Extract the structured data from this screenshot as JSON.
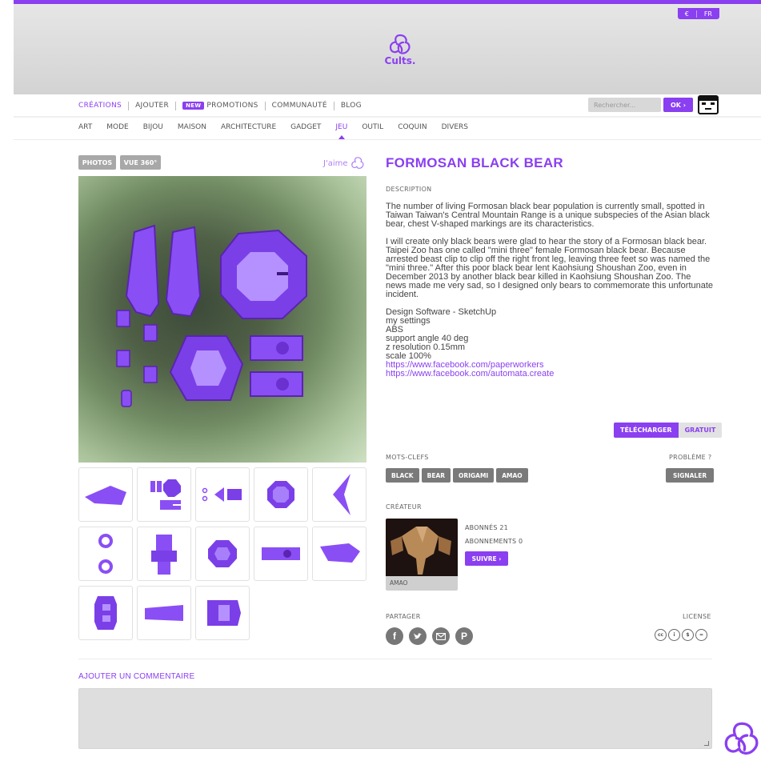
{
  "header": {
    "lang": [
      "€",
      "FR"
    ],
    "logo_word": "Cults.",
    "brand_color": "#8a3ff0"
  },
  "main_nav": {
    "items": [
      {
        "label": "CRÉATIONS"
      },
      {
        "label": "AJOUTER"
      },
      {
        "badge": "NEW",
        "label": "PROMOTIONS"
      },
      {
        "label": "COMMUNAUTÉ"
      },
      {
        "label": "BLOG"
      }
    ],
    "search_placeholder": "Rechercher...",
    "ok_label": "OK ›"
  },
  "sub_nav": [
    "ART",
    "MODE",
    "BIJOU",
    "MAISON",
    "ARCHITECTURE",
    "GADGET",
    "JEU",
    "OUTIL",
    "COQUIN",
    "DIVERS"
  ],
  "gallery": {
    "tab_photos": "PHOTOS",
    "tab_360": "VUE 360°",
    "like_label": "J'aime"
  },
  "product": {
    "title": "FORMOSAN BLACK BEAR",
    "description_label": "DESCRIPTION",
    "paragraphs": [
      "The number of living Formosan black bear population is currently small, spotted in Taiwan Taiwan's Central Mountain Range is a unique subspecies of the Asian black bear, chest V-shaped markings are its characteristics.",
      "I will create only black bears were glad to hear the story of a Formosan black bear.\nTaipei Zoo has one called \"mini three\" female Formosan black bear. Because arrested beast clip to clip off the right front leg, leaving three feet so was named the \"mini three.\" After this poor black bear lent Kaohsiung Shoushan Zoo, even in December 2013 by another black bear killed in Kaohsiung Shoushan Zoo. The news made me very sad, so I designed only bears to commemorate this unfortunate incident.",
      "Design Software - SketchUp\nmy settings\nABS\nsupport angle 40 deg\nz resolution 0.15mm\nscale 100%"
    ],
    "links": [
      "https://www.facebook.com/paperworkers",
      "https://www.facebook.com/automata.create"
    ],
    "download_label": "TÉLÉCHARGER",
    "price_label": "GRATUIT"
  },
  "keywords": {
    "label": "MOTS-CLEFS",
    "tags": [
      "BLACK",
      "BEAR",
      "ORIGAMI",
      "AMAO"
    ],
    "problem_label": "PROBLÈME ?",
    "report_label": "SIGNALER"
  },
  "creator": {
    "label": "CRÉATEUR",
    "name": "AMAO",
    "followers": "ABONNÉS 21",
    "following": "ABONNEMENTS 0",
    "follow_label": "SUIVRE ›"
  },
  "share": {
    "label": "PARTAGER",
    "icons": [
      "facebook-icon",
      "twitter-icon",
      "email-icon",
      "pinterest-icon"
    ],
    "license_label": "LICENSE"
  },
  "comment": {
    "title": "AJOUTER UN COMMENTAIRE"
  }
}
